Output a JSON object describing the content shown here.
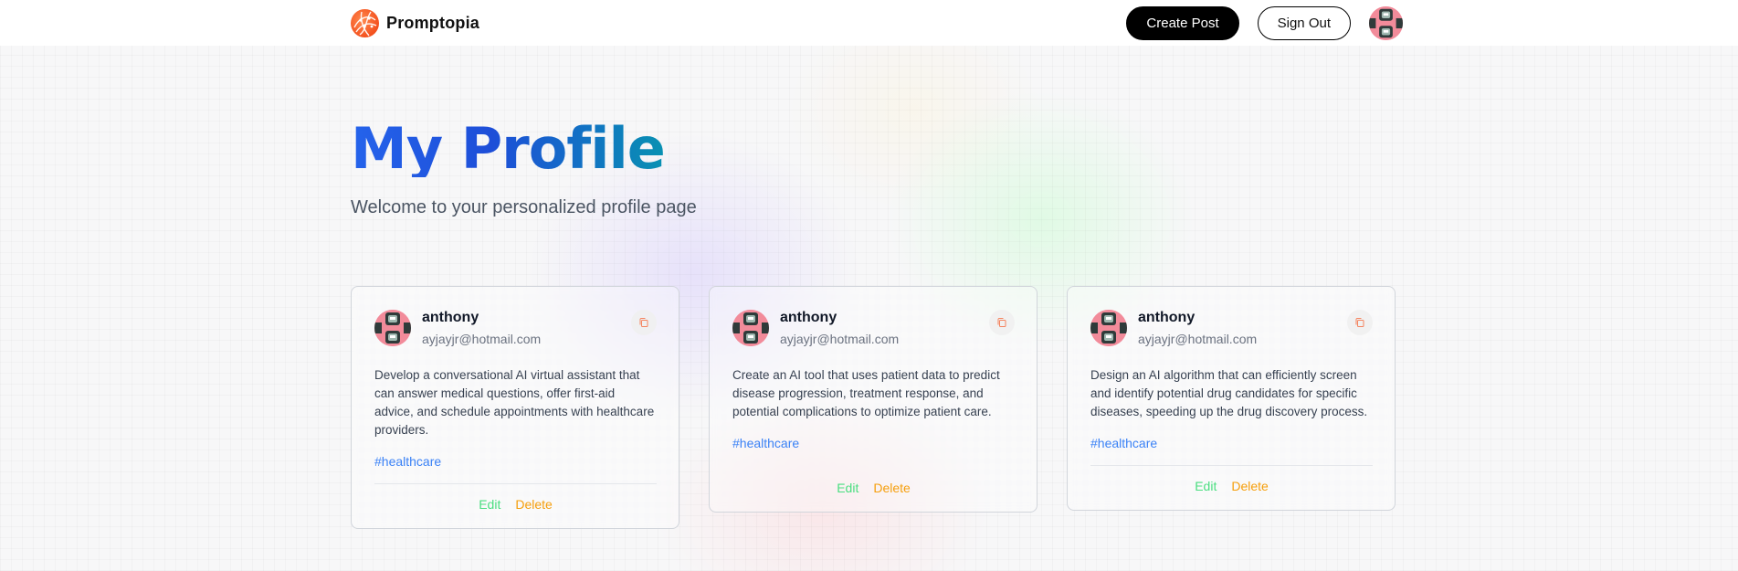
{
  "navbar": {
    "brand": "Promptopia",
    "create_post": "Create Post",
    "sign_out": "Sign Out",
    "logo_icon": "globe-logo-icon",
    "avatar_icon": "user-avatar"
  },
  "header": {
    "title": "My Profile",
    "subtitle": "Welcome to your personalized profile page"
  },
  "colors": {
    "accent_blue": "#2563eb",
    "accent_cyan": "#0891b2",
    "tag_blue": "#3b82f6",
    "edit_green": "#4ade80",
    "delete_orange": "#f59e0b",
    "logo_orange": "#f4511e"
  },
  "posts": [
    {
      "username": "anthony",
      "email": "ayjayjr@hotmail.com",
      "prompt": "Develop a conversational AI virtual assistant that can answer medical questions, offer first-aid advice, and schedule appointments with healthcare providers.",
      "tag": "#healthcare",
      "edit": "Edit",
      "delete": "Delete"
    },
    {
      "username": "anthony",
      "email": "ayjayjr@hotmail.com",
      "prompt": "Create an AI tool that uses patient data to predict disease progression, treatment response, and potential complications to optimize patient care.",
      "tag": "#healthcare",
      "edit": "Edit",
      "delete": "Delete"
    },
    {
      "username": "anthony",
      "email": "ayjayjr@hotmail.com",
      "prompt": "Design an AI algorithm that can efficiently screen and identify potential drug candidates for specific diseases, speeding up the drug discovery process.",
      "tag": "#healthcare",
      "edit": "Edit",
      "delete": "Delete"
    }
  ]
}
